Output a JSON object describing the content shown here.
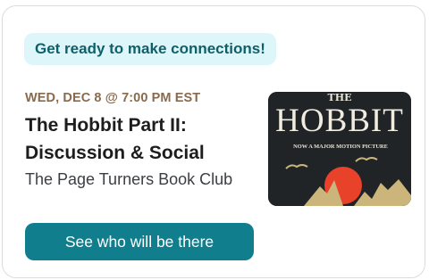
{
  "card": {
    "banner": "Get ready to make connections!",
    "date": "WED, DEC 8 @ 7:00 PM EST",
    "title_line1": "The Hobbit Part II:",
    "title_line2": "Discussion & Social",
    "host": "The Page Turners Book Club",
    "cta_label": "See who will be there",
    "cover": {
      "small_title": "THE",
      "big_title": "HOBBIT",
      "tagline": "NOW A MAJOR MOTION PICTURE"
    }
  },
  "colors": {
    "banner_bg": "#ddf6f9",
    "banner_text": "#0f5f6b",
    "date_text": "#8a6a4c",
    "cta_bg": "#117e8d",
    "sun": "#e8432a",
    "mountains": "#cbb57a"
  }
}
